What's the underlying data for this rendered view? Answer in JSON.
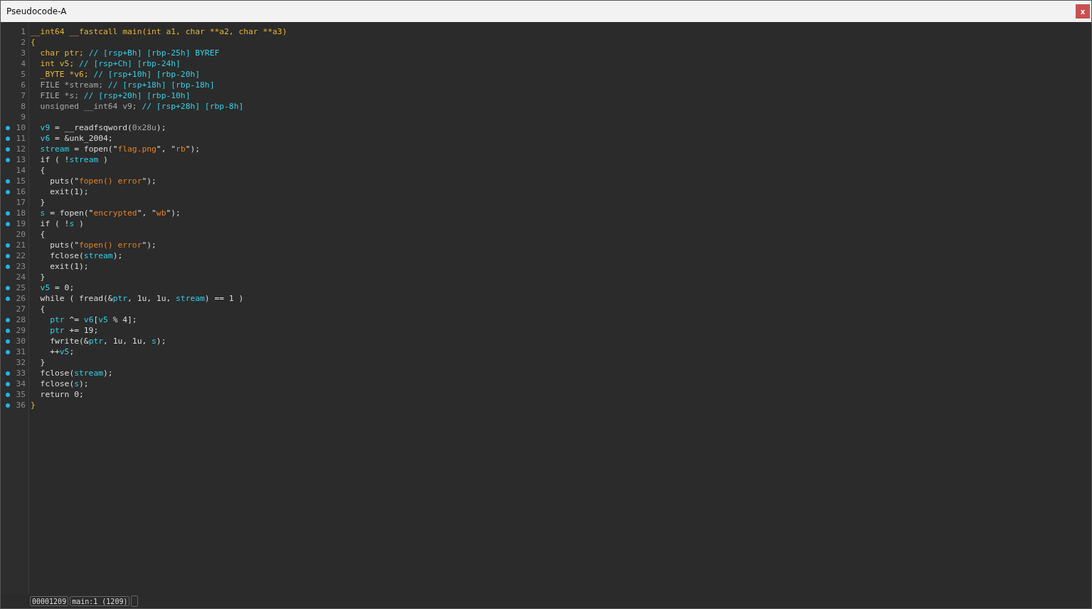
{
  "window": {
    "title": "Pseudocode-A",
    "close": "x"
  },
  "lines": [
    {
      "number": "1",
      "dot": false,
      "tokens": [
        {
          "kind": "decl",
          "text": "__int64 __fastcall main(int a1, char **a2, char **a3)"
        }
      ]
    },
    {
      "number": "2",
      "dot": false,
      "tokens": [
        {
          "kind": "decl",
          "text": "{"
        }
      ]
    },
    {
      "number": "3",
      "dot": false,
      "tokens": [
        {
          "kind": "decl",
          "text": "  char ptr;"
        },
        {
          "kind": "var",
          "text": " // [rsp+Bh] [rbp-25h] BYREF"
        }
      ]
    },
    {
      "number": "4",
      "dot": false,
      "tokens": [
        {
          "kind": "decl",
          "text": "  int v5;"
        },
        {
          "kind": "var",
          "text": " // [rsp+Ch] [rbp-24h]"
        }
      ]
    },
    {
      "number": "5",
      "dot": false,
      "tokens": [
        {
          "kind": "decl",
          "text": "  _BYTE *v6;"
        },
        {
          "kind": "var",
          "text": " // [rsp+10h] [rbp-20h]"
        }
      ]
    },
    {
      "number": "6",
      "dot": false,
      "tokens": [
        {
          "kind": "dim",
          "text": "  FILE *stream;"
        },
        {
          "kind": "var",
          "text": " // [rsp+18h] [rbp-18h]"
        }
      ]
    },
    {
      "number": "7",
      "dot": false,
      "tokens": [
        {
          "kind": "dim",
          "text": "  FILE *s;"
        },
        {
          "kind": "var",
          "text": " // [rsp+20h] [rbp-10h]"
        }
      ]
    },
    {
      "number": "8",
      "dot": false,
      "tokens": [
        {
          "kind": "dim",
          "text": "  unsigned __int64 v9;"
        },
        {
          "kind": "var",
          "text": " // [rsp+28h] [rbp-8h]"
        }
      ]
    },
    {
      "number": "9",
      "dot": false
    },
    {
      "number": "10",
      "dot": true,
      "tokens": [
        {
          "kind": "var",
          "text": "  v9"
        },
        {
          "kind": "plain",
          "text": " = __readfsqword("
        },
        {
          "kind": "dim",
          "text": "0x28u"
        },
        {
          "kind": "plain",
          "text": ");"
        }
      ]
    },
    {
      "number": "11",
      "dot": true,
      "tokens": [
        {
          "kind": "var",
          "text": "  v6"
        },
        {
          "kind": "plain",
          "text": " = &unk_2004;"
        }
      ]
    },
    {
      "number": "12",
      "dot": true,
      "tokens": [
        {
          "kind": "var",
          "text": "  stream"
        },
        {
          "kind": "plain",
          "text": " = fopen(\""
        },
        {
          "kind": "string",
          "text": "flag.png"
        },
        {
          "kind": "plain",
          "text": "\", \""
        },
        {
          "kind": "string",
          "text": "rb"
        },
        {
          "kind": "plain",
          "text": "\");"
        }
      ]
    },
    {
      "number": "13",
      "dot": true,
      "tokens": [
        {
          "kind": "plain",
          "text": "  if ( !"
        },
        {
          "kind": "var",
          "text": "stream"
        },
        {
          "kind": "plain",
          "text": " )"
        }
      ]
    },
    {
      "number": "14",
      "dot": false,
      "tokens": [
        {
          "kind": "plain",
          "text": "  {"
        }
      ]
    },
    {
      "number": "15",
      "dot": true,
      "tokens": [
        {
          "kind": "plain",
          "text": "    puts(\""
        },
        {
          "kind": "string",
          "text": "fopen() error"
        },
        {
          "kind": "plain",
          "text": "\");"
        }
      ]
    },
    {
      "number": "16",
      "dot": true,
      "tokens": [
        {
          "kind": "plain",
          "text": "    exit(1);"
        }
      ]
    },
    {
      "number": "17",
      "dot": false,
      "tokens": [
        {
          "kind": "plain",
          "text": "  }"
        }
      ]
    },
    {
      "number": "18",
      "dot": true,
      "tokens": [
        {
          "kind": "var",
          "text": "  s"
        },
        {
          "kind": "plain",
          "text": " = fopen(\""
        },
        {
          "kind": "string",
          "text": "encrypted"
        },
        {
          "kind": "plain",
          "text": "\", \""
        },
        {
          "kind": "string",
          "text": "wb"
        },
        {
          "kind": "plain",
          "text": "\");"
        }
      ]
    },
    {
      "number": "19",
      "dot": true,
      "tokens": [
        {
          "kind": "plain",
          "text": "  if ( !"
        },
        {
          "kind": "var",
          "text": "s"
        },
        {
          "kind": "plain",
          "text": " )"
        }
      ]
    },
    {
      "number": "20",
      "dot": false,
      "tokens": [
        {
          "kind": "plain",
          "text": "  {"
        }
      ]
    },
    {
      "number": "21",
      "dot": true,
      "tokens": [
        {
          "kind": "plain",
          "text": "    puts(\""
        },
        {
          "kind": "string",
          "text": "fopen() error"
        },
        {
          "kind": "plain",
          "text": "\");"
        }
      ]
    },
    {
      "number": "22",
      "dot": true,
      "tokens": [
        {
          "kind": "plain",
          "text": "    fclose("
        },
        {
          "kind": "var",
          "text": "stream"
        },
        {
          "kind": "plain",
          "text": ");"
        }
      ]
    },
    {
      "number": "23",
      "dot": true,
      "tokens": [
        {
          "kind": "plain",
          "text": "    exit(1);"
        }
      ]
    },
    {
      "number": "24",
      "dot": false,
      "tokens": [
        {
          "kind": "plain",
          "text": "  }"
        }
      ]
    },
    {
      "number": "25",
      "dot": true,
      "tokens": [
        {
          "kind": "var",
          "text": "  v5"
        },
        {
          "kind": "plain",
          "text": " = 0;"
        }
      ]
    },
    {
      "number": "26",
      "dot": true,
      "tokens": [
        {
          "kind": "plain",
          "text": "  while ( fread(&"
        },
        {
          "kind": "var",
          "text": "ptr"
        },
        {
          "kind": "plain",
          "text": ", 1u, 1u, "
        },
        {
          "kind": "var",
          "text": "stream"
        },
        {
          "kind": "plain",
          "text": ") == 1 )"
        }
      ]
    },
    {
      "number": "27",
      "dot": false,
      "tokens": [
        {
          "kind": "plain",
          "text": "  {"
        }
      ]
    },
    {
      "number": "28",
      "dot": true,
      "tokens": [
        {
          "kind": "var",
          "text": "    ptr"
        },
        {
          "kind": "plain",
          "text": " ^= "
        },
        {
          "kind": "var",
          "text": "v6"
        },
        {
          "kind": "plain",
          "text": "["
        },
        {
          "kind": "var",
          "text": "v5"
        },
        {
          "kind": "plain",
          "text": " % 4];"
        }
      ]
    },
    {
      "number": "29",
      "dot": true,
      "tokens": [
        {
          "kind": "var",
          "text": "    ptr"
        },
        {
          "kind": "plain",
          "text": " += 19;"
        }
      ]
    },
    {
      "number": "30",
      "dot": true,
      "tokens": [
        {
          "kind": "plain",
          "text": "    fwrite(&"
        },
        {
          "kind": "var",
          "text": "ptr"
        },
        {
          "kind": "plain",
          "text": ", 1u, 1u, "
        },
        {
          "kind": "var",
          "text": "s"
        },
        {
          "kind": "plain",
          "text": ");"
        }
      ]
    },
    {
      "number": "31",
      "dot": true,
      "tokens": [
        {
          "kind": "plain",
          "text": "    ++"
        },
        {
          "kind": "var",
          "text": "v5"
        },
        {
          "kind": "plain",
          "text": ";"
        }
      ]
    },
    {
      "number": "32",
      "dot": false,
      "tokens": [
        {
          "kind": "plain",
          "text": "  }"
        }
      ]
    },
    {
      "number": "33",
      "dot": true,
      "tokens": [
        {
          "kind": "plain",
          "text": "  fclose("
        },
        {
          "kind": "var",
          "text": "stream"
        },
        {
          "kind": "plain",
          "text": ");"
        }
      ]
    },
    {
      "number": "34",
      "dot": true,
      "tokens": [
        {
          "kind": "plain",
          "text": "  fclose("
        },
        {
          "kind": "var",
          "text": "s"
        },
        {
          "kind": "plain",
          "text": ");"
        }
      ]
    },
    {
      "number": "35",
      "dot": true,
      "tokens": [
        {
          "kind": "plain",
          "text": "  return 0;"
        }
      ]
    },
    {
      "number": "36",
      "dot": true,
      "tokens": [
        {
          "kind": "decl",
          "text": "}"
        }
      ]
    }
  ],
  "status_bar": [
    "00001209",
    "main:1 (1209)"
  ]
}
